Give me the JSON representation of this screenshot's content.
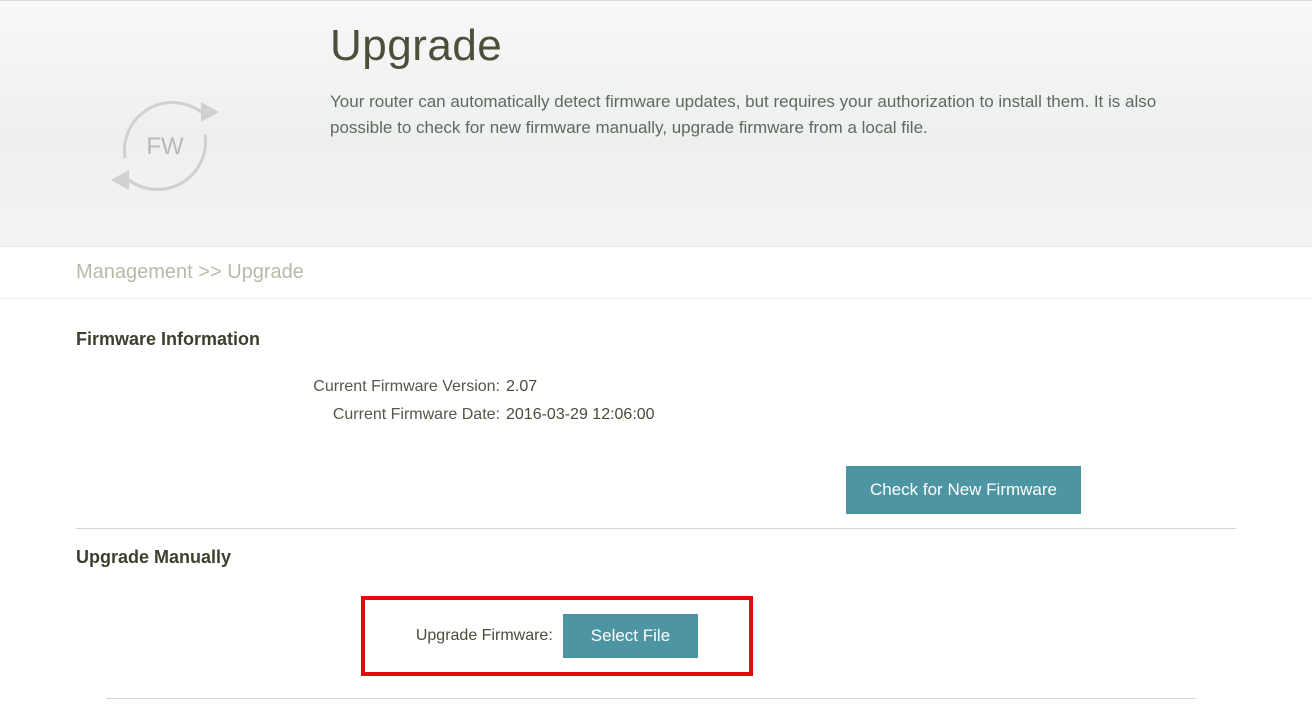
{
  "header": {
    "icon_text": "FW",
    "title": "Upgrade",
    "description": "Your router can automatically detect firmware updates, but requires your authorization to install them. It is also possible to check for new firmware manually, upgrade firmware from a local file."
  },
  "breadcrumb": {
    "text": "Management >> Upgrade"
  },
  "firmware_info": {
    "section_title": "Firmware Information",
    "version_label": "Current Firmware Version:",
    "version_value": "2.07",
    "date_label": "Current Firmware Date:",
    "date_value": "2016-03-29 12:06:00",
    "check_button": "Check for New Firmware"
  },
  "upgrade_manual": {
    "section_title": "Upgrade Manually",
    "field_label": "Upgrade Firmware:",
    "select_button": "Select File"
  }
}
